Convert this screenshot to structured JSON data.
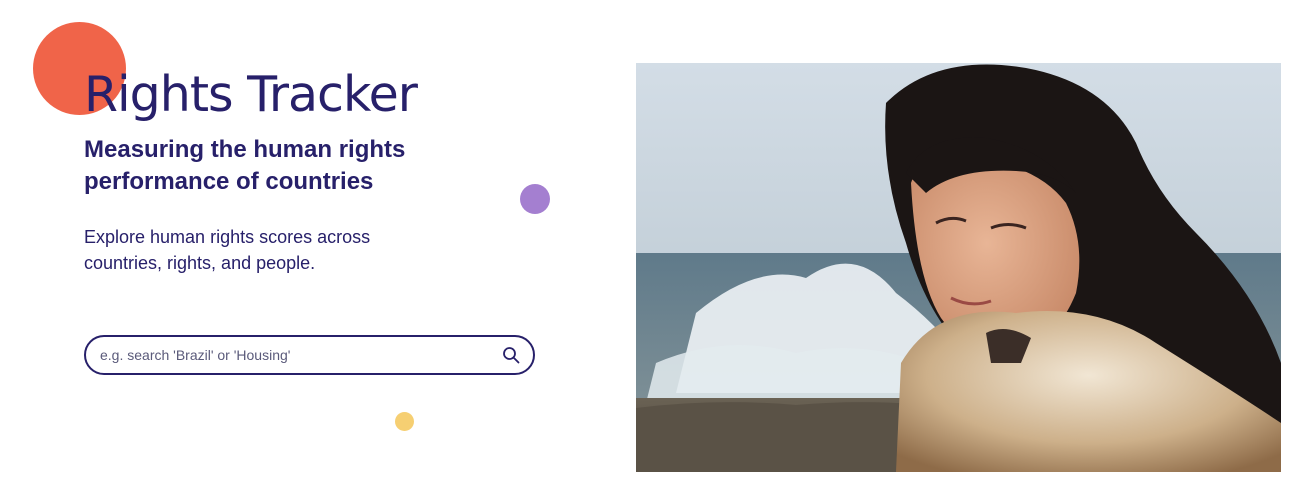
{
  "hero": {
    "title": "Rights Tracker",
    "subtitle": "Measuring the human rights performance of countries",
    "description": "Explore human rights scores across countries, rights, and people."
  },
  "search": {
    "placeholder": "e.g. search 'Brazil' or 'Housing'",
    "value": "",
    "icon": "search-icon"
  },
  "colors": {
    "brand_navy": "#27206a",
    "accent_orange": "#f06449",
    "accent_purple": "#a47fd0",
    "accent_yellow": "#f6cf72"
  }
}
